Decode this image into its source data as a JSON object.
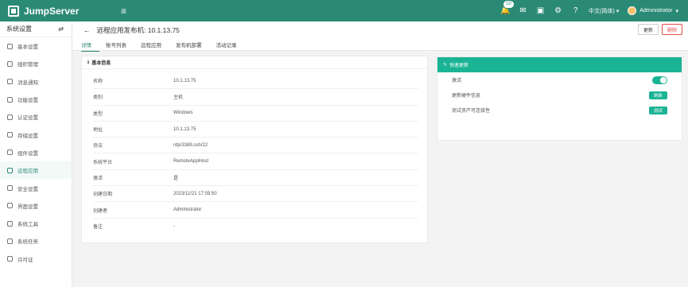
{
  "topbar": {
    "brand": "JumpServer",
    "collapse_glyph": "≡",
    "notification_count": "10",
    "language": "中文(简体)",
    "user": "Administrator",
    "icons": [
      "bell-icon",
      "mail-icon",
      "monitor-icon",
      "gear-icon",
      "help-icon"
    ]
  },
  "sidebar": {
    "title": "系统设置",
    "items": [
      {
        "label": "基本设置"
      },
      {
        "label": "组织管理"
      },
      {
        "label": "消息通知"
      },
      {
        "label": "功能设置"
      },
      {
        "label": "认证设置"
      },
      {
        "label": "存储设置"
      },
      {
        "label": "组件设置"
      },
      {
        "label": "远程应用"
      },
      {
        "label": "安全设置"
      },
      {
        "label": "界面设置"
      },
      {
        "label": "系统工具"
      },
      {
        "label": "系统任务"
      },
      {
        "label": "许可证"
      }
    ]
  },
  "page": {
    "back": "←",
    "title": "远程应用发布机: 10.1.13.75",
    "update_label": "更新",
    "delete_label": "删除",
    "tabs": [
      {
        "label": "详情"
      },
      {
        "label": "账号列表"
      },
      {
        "label": "远程应用"
      },
      {
        "label": "发布机部署"
      },
      {
        "label": "活动记录"
      }
    ]
  },
  "basic": {
    "title": "基本信息",
    "rows": [
      {
        "k": "名称",
        "v": "10.1.13.75"
      },
      {
        "k": "类别",
        "v": "主机"
      },
      {
        "k": "类型",
        "v": "Windows"
      },
      {
        "k": "地址",
        "v": "10.1.13.75"
      },
      {
        "k": "协议",
        "v": "rdp/3389,ssh/22"
      },
      {
        "k": "系统平台",
        "v": "RemoteAppHost"
      },
      {
        "k": "激活",
        "v": "是"
      },
      {
        "k": "创建日期",
        "v": "2023/11/21 17:59:50"
      },
      {
        "k": "创建者",
        "v": "Administrator"
      },
      {
        "k": "备注",
        "v": "-"
      }
    ]
  },
  "quick": {
    "title": "快速更新",
    "active_label": "激活",
    "refresh_label": "更新硬件信息",
    "refresh_btn": "刷新",
    "test_label": "测试资产可连接性",
    "test_btn": "测试"
  }
}
